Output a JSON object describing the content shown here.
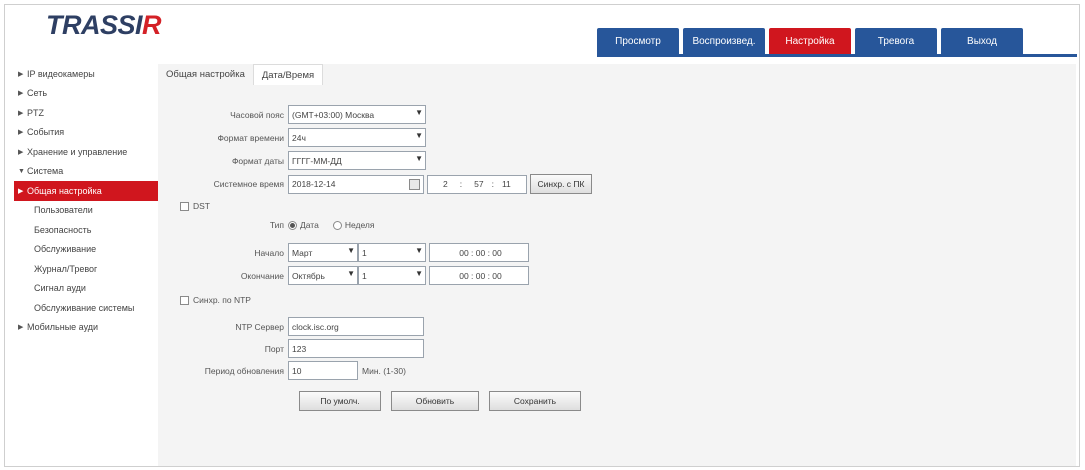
{
  "brand": {
    "logo_main": "TRASSI",
    "logo_accent": "R"
  },
  "topnav": [
    {
      "label": "Просмотр",
      "active": false
    },
    {
      "label": "Воспроизвед.",
      "active": false
    },
    {
      "label": "Настройка",
      "active": true
    },
    {
      "label": "Тревога",
      "active": false
    },
    {
      "label": "Выход",
      "active": false
    }
  ],
  "sidebar": {
    "items": [
      {
        "label": "IP видеокамеры",
        "arrow": "▶"
      },
      {
        "label": "Сеть",
        "arrow": "▶"
      },
      {
        "label": "PTZ",
        "arrow": "▶"
      },
      {
        "label": "События",
        "arrow": "▶"
      },
      {
        "label": "Хранение и управление",
        "arrow": "▶"
      },
      {
        "label": "Система",
        "arrow": "▼"
      },
      {
        "label": "Общая настройка",
        "arrow": "▶"
      },
      {
        "label": "Пользователи"
      },
      {
        "label": "Безопасность"
      },
      {
        "label": "Обслуживание"
      },
      {
        "label": "Журнал/Тревог"
      },
      {
        "label": "Сигнал ауди"
      },
      {
        "label": "Обслуживание системы"
      },
      {
        "label": "Мобильные ауди",
        "arrow": "▶"
      }
    ]
  },
  "subtabs": {
    "general": "Общая настройка",
    "datetime": "Дата/Время"
  },
  "form": {
    "timezone_label": "Часовой пояс",
    "timezone_value": "(GMT+03:00) Москва",
    "time_format_label": "Формат времени",
    "time_format_value": "24ч",
    "date_format_label": "Формат даты",
    "date_format_value": "ГГГГ-ММ-ДД",
    "sys_time_label": "Системное время",
    "sys_time_date": "2018-12-14",
    "sys_time_h": "2",
    "sys_time_m": "57",
    "sys_time_s": "11",
    "sync_button": "Синхр. с ПК",
    "dst_checkbox": "DST",
    "type_label": "Тип",
    "type_option_date": "Дата",
    "type_option_week": "Неделя",
    "start_label": "Начало",
    "start_month": "Март",
    "start_day": "1",
    "start_time": "00 : 00 : 00",
    "end_label": "Окончание",
    "end_month": "Октябрь",
    "end_day": "1",
    "end_time": "00 : 00 : 00",
    "ntp_checkbox": "Синхр. по NTP",
    "ntp_server_label": "NTP Сервер",
    "ntp_server_value": "clock.isc.org",
    "port_label": "Порт",
    "port_value": "123",
    "update_label": "Период обновления",
    "update_value": "10",
    "update_unit": "Мин. (1-30)"
  },
  "buttons": {
    "default": "По умолч.",
    "refresh": "Обновить",
    "save": "Сохранить"
  }
}
